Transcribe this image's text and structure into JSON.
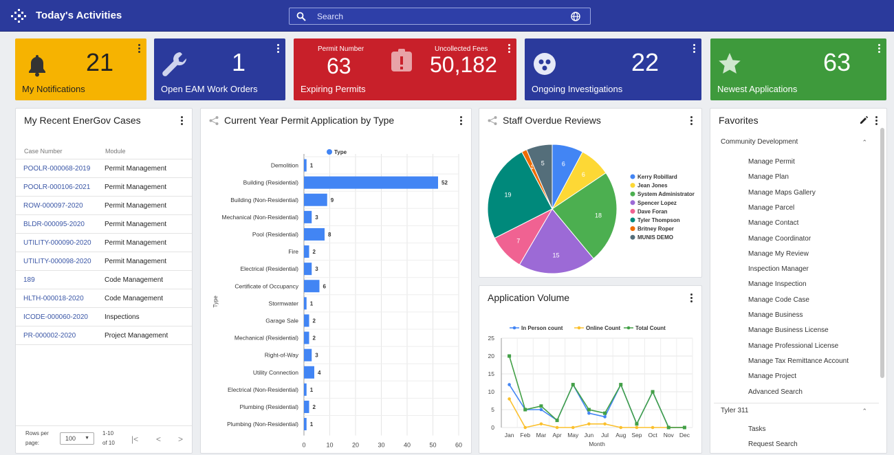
{
  "header": {
    "title": "Today's Activities",
    "search_placeholder": "Search"
  },
  "tiles": {
    "notifications": {
      "value": "21",
      "label": "My Notifications"
    },
    "eam": {
      "value": "1",
      "label": "Open EAM Work Orders"
    },
    "permits": {
      "permit_number_label": "Permit Number",
      "permit_value": "63",
      "fees_label": "Uncollected Fees",
      "fees_value": "50,182",
      "label": "Expiring Permits"
    },
    "investigations": {
      "value": "22",
      "label": "Ongoing Investigations"
    },
    "applications": {
      "value": "63",
      "label": "Newest Applications"
    }
  },
  "cases": {
    "title": "My Recent EnerGov Cases",
    "col_case": "Case Number",
    "col_module": "Module",
    "rows": [
      {
        "case": "POOLR-000068-2019",
        "module": "Permit Management"
      },
      {
        "case": "POOLR-000106-2021",
        "module": "Permit Management"
      },
      {
        "case": "ROW-000097-2020",
        "module": "Permit Management"
      },
      {
        "case": "BLDR-000095-2020",
        "module": "Permit Management"
      },
      {
        "case": "UTILITY-000090-2020",
        "module": "Permit Management"
      },
      {
        "case": "UTILITY-000098-2020",
        "module": "Permit Management"
      },
      {
        "case": "189",
        "module": "Code Management"
      },
      {
        "case": "HLTH-000018-2020",
        "module": "Code Management"
      },
      {
        "case": "ICODE-000060-2020",
        "module": "Inspections"
      },
      {
        "case": "PR-000002-2020",
        "module": "Project Management"
      }
    ],
    "pager": {
      "rows_label_1": "Rows per",
      "rows_label_2": "page:",
      "rows_value": "100",
      "range_1": "1-10",
      "range_2": "of 10"
    }
  },
  "chart_data": [
    {
      "type": "bar",
      "title": "Current Year Permit Application by Type",
      "ylabel": "Type",
      "legend": "Type",
      "categories": [
        "Demolition",
        "Building (Residential)",
        "Building (Non-Residential)",
        "Mechanical (Non-Residential)",
        "Pool (Residential)",
        "Fire",
        "Electrical (Residential)",
        "Certificate of Occupancy",
        "Stormwater",
        "Garage Sale",
        "Mechanical (Residential)",
        "Right-of-Way",
        "Utility Connection",
        "Electrical (Non-Residential)",
        "Plumbing (Residential)",
        "Plumbing (Non-Residential)"
      ],
      "values": [
        1,
        52,
        9,
        3,
        8,
        2,
        3,
        6,
        1,
        2,
        2,
        3,
        4,
        1,
        2,
        1
      ],
      "xlim": [
        0,
        60
      ],
      "xticks": [
        0,
        10,
        20,
        30,
        40,
        50,
        60
      ],
      "color": "#4285f4"
    },
    {
      "type": "pie",
      "title": "Staff Overdue Reviews",
      "labels": [
        "Kerry Robillard",
        "Jean Jones",
        "System Administrator",
        "Spencer Lopez",
        "Dave Foran",
        "Tyler Thompson",
        "Britney Roper",
        "MUNIS DEMO"
      ],
      "values": [
        6,
        6,
        18,
        15,
        7,
        19,
        1,
        5
      ],
      "colors": [
        "#4285f4",
        "#fdd835",
        "#4caf50",
        "#9c6ad6",
        "#f06292",
        "#00897b",
        "#ef6c00",
        "#546e7a"
      ]
    },
    {
      "type": "line",
      "title": "Application Volume",
      "xlabel": "Month",
      "categories": [
        "Jan",
        "Feb",
        "Mar",
        "Apr",
        "May",
        "Jun",
        "Jul",
        "Aug",
        "Sep",
        "Oct",
        "Nov",
        "Dec"
      ],
      "ylim": [
        0,
        25
      ],
      "yticks": [
        0,
        5,
        10,
        15,
        20,
        25
      ],
      "series": [
        {
          "name": "In Person count",
          "color": "#4285f4",
          "values": [
            12,
            5,
            5,
            2,
            12,
            4,
            3,
            12,
            1,
            10,
            0,
            0
          ]
        },
        {
          "name": "Online Count",
          "color": "#fbc02d",
          "values": [
            8,
            0,
            1,
            0,
            0,
            1,
            1,
            0,
            0,
            0,
            0,
            0
          ]
        },
        {
          "name": "Total Count",
          "color": "#43a047",
          "values": [
            20,
            5,
            6,
            2,
            12,
            5,
            4,
            12,
            1,
            10,
            0,
            0
          ]
        }
      ]
    }
  ],
  "favorites": {
    "title": "Favorites",
    "group1": "Community Development",
    "items": [
      "Manage Permit",
      "Manage Plan",
      "Manage Maps Gallery",
      "Manage Parcel",
      "Manage Contact",
      "Manage Coordinator",
      "Manage My Review",
      "Inspection Manager",
      "Manage Inspection",
      "Manage Code Case",
      "Manage Business",
      "Manage Business License",
      "Manage Professional License",
      "Manage Tax Remittance Account",
      "Manage Project",
      "Advanced Search"
    ],
    "group2": "Tyler 311",
    "items2": [
      "Tasks",
      "Request Search"
    ]
  },
  "icons": [
    "logo-icon",
    "search-icon",
    "globe-icon",
    "bell-icon",
    "wrench-icon",
    "clipboard-alert-icon",
    "investigation-icon",
    "star-icon",
    "share-icon",
    "pencil-icon",
    "kebab-icon"
  ]
}
